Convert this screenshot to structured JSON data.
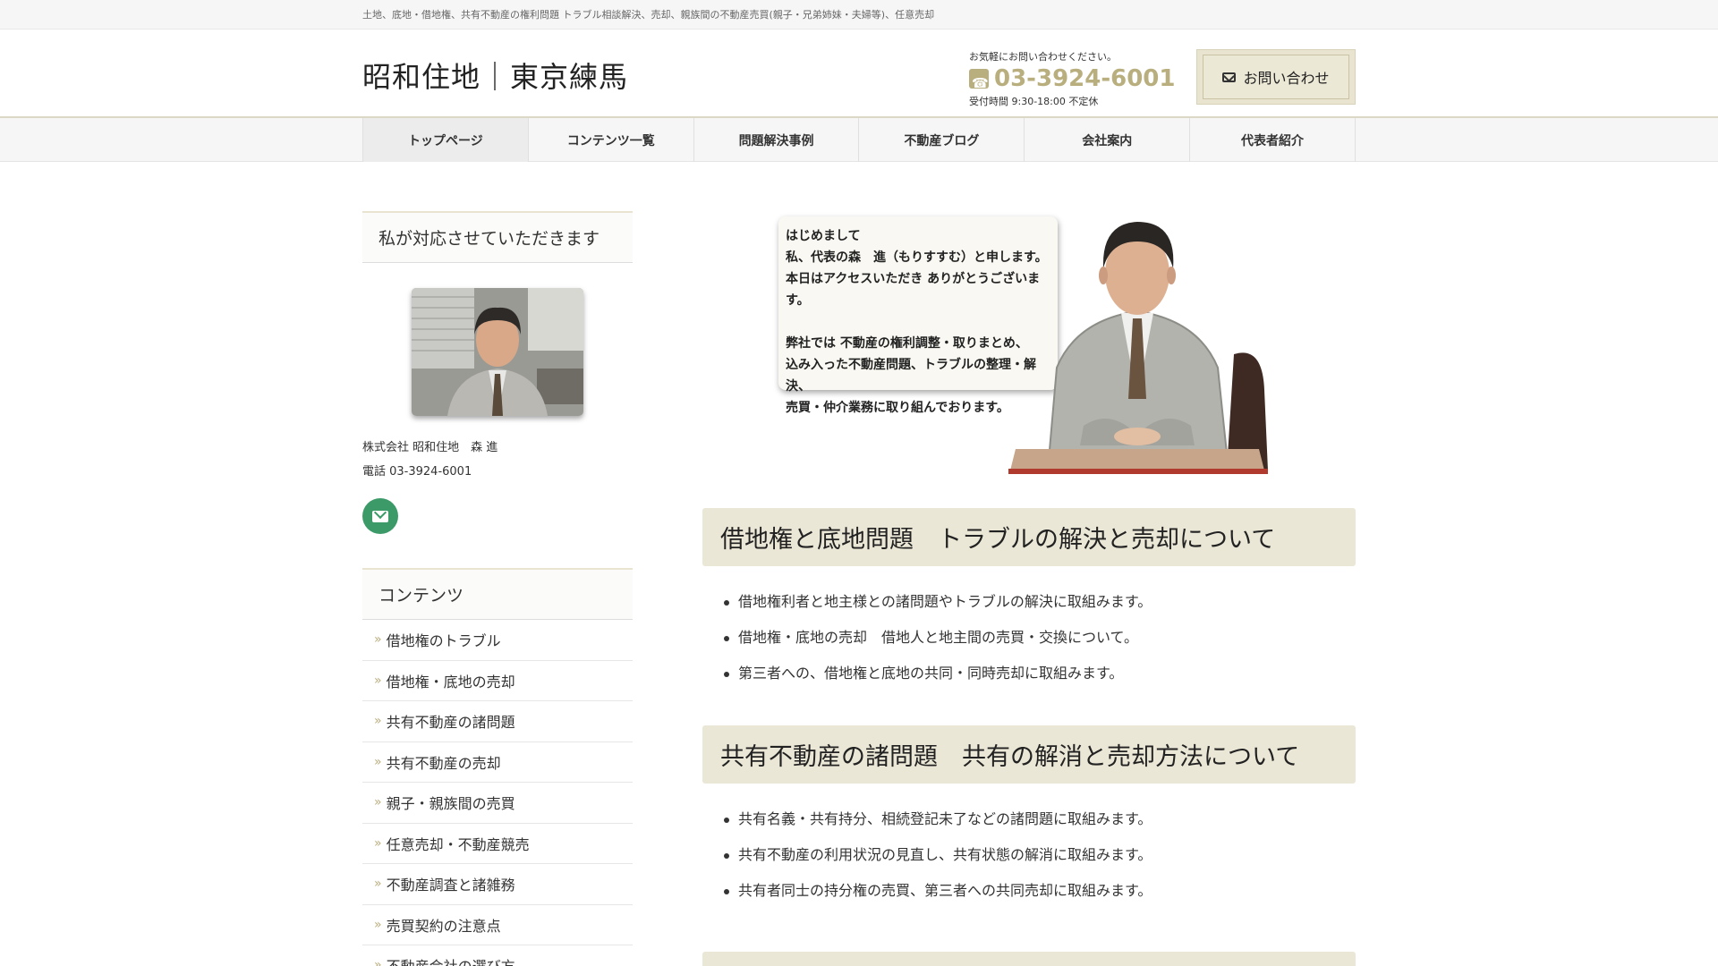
{
  "topbar": {
    "tagline": "土地、底地・借地権、共有不動産の権利問題 トラブル相談解決、売却、親族間の不動産売買(親子・兄弟姉妹・夫婦等)、任意売却"
  },
  "header": {
    "logo": "昭和住地｜東京練馬",
    "contact_note": "お気軽にお問い合わせください。",
    "phone": "03-3924-6001",
    "hours": "受付時間 9:30-18:00 不定休",
    "contact_button": "お問い合わせ"
  },
  "nav": {
    "items": [
      {
        "label": "トップページ"
      },
      {
        "label": "コンテンツ一覧"
      },
      {
        "label": "問題解決事例"
      },
      {
        "label": "不動産ブログ"
      },
      {
        "label": "会社案内"
      },
      {
        "label": "代表者紹介"
      }
    ]
  },
  "sidebar": {
    "profile_heading": "私が対応させていただきます",
    "company_name": "株式会社 昭和住地　森 進",
    "phone_line": "電話 03-3924-6001",
    "contents_heading": "コンテンツ",
    "items": [
      {
        "label": "借地権のトラブル"
      },
      {
        "label": "借地権・底地の売却"
      },
      {
        "label": "共有不動産の諸問題"
      },
      {
        "label": "共有不動産の売却"
      },
      {
        "label": "親子・親族間の売買"
      },
      {
        "label": "任意売却・不動産競売"
      },
      {
        "label": "不動産調査と諸雑務"
      },
      {
        "label": "売買契約の注意点"
      },
      {
        "label": "不動産会社の選び方"
      }
    ]
  },
  "hero": {
    "lines": [
      "はじめまして",
      "私、代表の森　進（もりすすむ）と申します。",
      "本日はアクセスいただき ありがとうございます。",
      "",
      "弊社では 不動産の権利調整・取りまとめ、",
      "込み入った不動産問題、トラブルの整理・解決、",
      "売買・仲介業務に取り組んでおります。"
    ]
  },
  "sections": [
    {
      "title": "借地権と底地問題　トラブルの解決と売却について",
      "items": [
        "借地権利者と地主様との諸問題やトラブルの解決に取組みます。",
        "借地権・底地の売却　借地人と地主間の売買・交換について。",
        "第三者への、借地権と底地の共同・同時売却に取組みます。"
      ]
    },
    {
      "title": "共有不動産の諸問題　共有の解消と売却方法について",
      "items": [
        "共有名義・共有持分、相続登記未了などの諸問題に取組みます。",
        "共有不動産の利用状況の見直し、共有状態の解消に取組みます。",
        "共有者同士の持分権の売買、第三者への共同売却に取組みます。"
      ]
    }
  ],
  "colors": {
    "accent": "#b9ae7e",
    "section_bg": "#ebe7d6",
    "mail_green": "#3b9a67"
  }
}
